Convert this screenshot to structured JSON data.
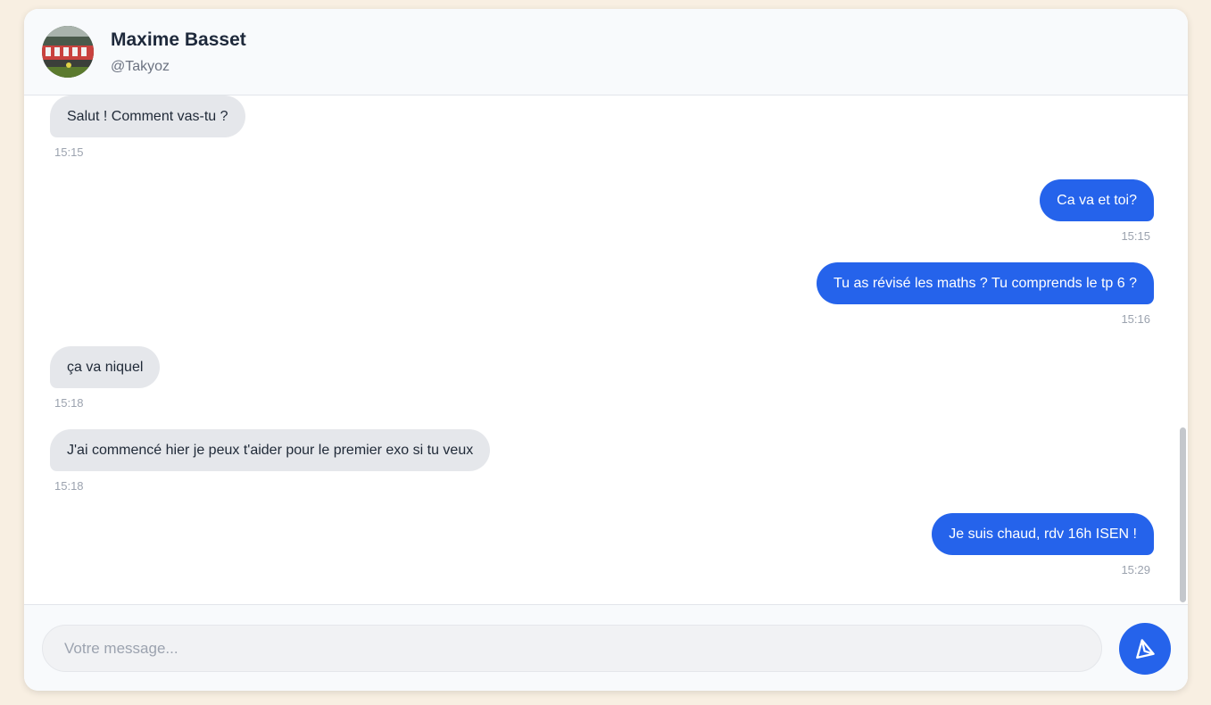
{
  "header": {
    "name": "Maxime Basset",
    "handle": "@Takyoz",
    "avatar_icon": "profile-photo"
  },
  "messages": [
    {
      "direction": "received",
      "text": "Salut ! Comment vas-tu ?",
      "time": "15:15"
    },
    {
      "direction": "sent",
      "text": "Ca va et toi?",
      "time": "15:15"
    },
    {
      "direction": "sent",
      "text": "Tu as révisé les maths ? Tu comprends le tp 6 ?",
      "time": "15:16"
    },
    {
      "direction": "received",
      "text": "ça va niquel",
      "time": "15:18"
    },
    {
      "direction": "received",
      "text": "J'ai commencé hier je peux t'aider pour le premier exo si tu veux",
      "time": "15:18"
    },
    {
      "direction": "sent",
      "text": "Je suis chaud, rdv 16h ISEN !",
      "time": "15:29"
    }
  ],
  "composer": {
    "placeholder": "Votre message...",
    "value": "",
    "send_icon": "send-icon"
  },
  "colors": {
    "page_background": "#f8efe2",
    "sent_bubble": "#2563eb",
    "received_bubble": "#e5e7eb",
    "send_button": "#2563eb"
  }
}
